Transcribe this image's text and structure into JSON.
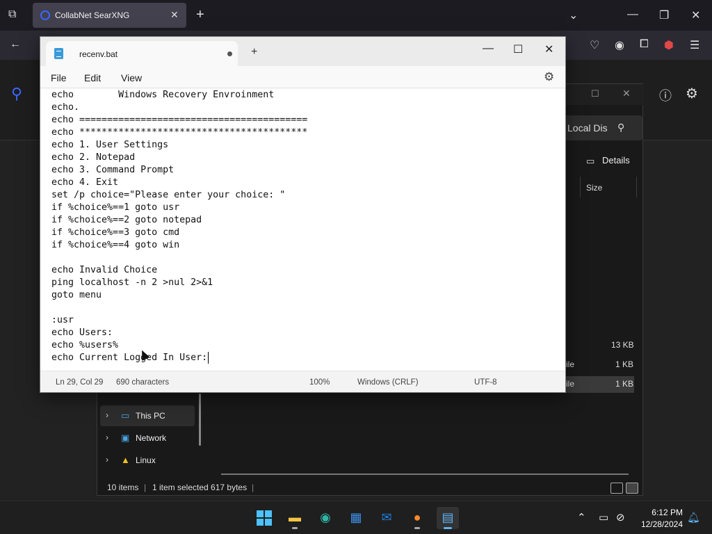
{
  "browser": {
    "tab_title": "CollabNet SearXNG",
    "tab_close": "✕",
    "new_tab": "+"
  },
  "explorer": {
    "search_text": "Local Dis",
    "details_label": "Details",
    "size_header": "Size",
    "sizes": [
      "13 KB",
      "1 KB",
      "1 KB"
    ],
    "row_fragments": [
      "ile",
      "ile"
    ],
    "nav": [
      {
        "label": "This PC"
      },
      {
        "label": "Network"
      },
      {
        "label": "Linux"
      }
    ],
    "status": {
      "items": "10 items",
      "selected": "1 item selected  617 bytes"
    }
  },
  "notepad": {
    "tab_title": "recenv.bat",
    "menu": {
      "file": "File",
      "edit": "Edit",
      "view": "View"
    },
    "lines": [
      "echo        Windows Recovery Envroinment",
      "echo.",
      "echo =========================================",
      "echo *****************************************",
      "echo 1. User Settings",
      "echo 2. Notepad",
      "echo 3. Command Prompt",
      "echo 4. Exit",
      "set /p choice=\"Please enter your choice: \"",
      "if %choice%==1 goto usr",
      "if %choice%==2 goto notepad",
      "if %choice%==3 goto cmd",
      "if %choice%==4 goto win",
      "",
      "echo Invalid Choice",
      "ping localhost -n 2 >nul 2>&1",
      "goto menu",
      "",
      ":usr",
      "echo Users:",
      "echo %users%",
      "echo Current Logged In User:"
    ],
    "status": {
      "position": "Ln 29, Col 29",
      "characters": "690 characters",
      "zoom": "100%",
      "line_ending": "Windows (CRLF)",
      "encoding": "UTF-8"
    }
  },
  "taskbar": {
    "time": "6:12 PM",
    "date": "12/28/2024"
  }
}
